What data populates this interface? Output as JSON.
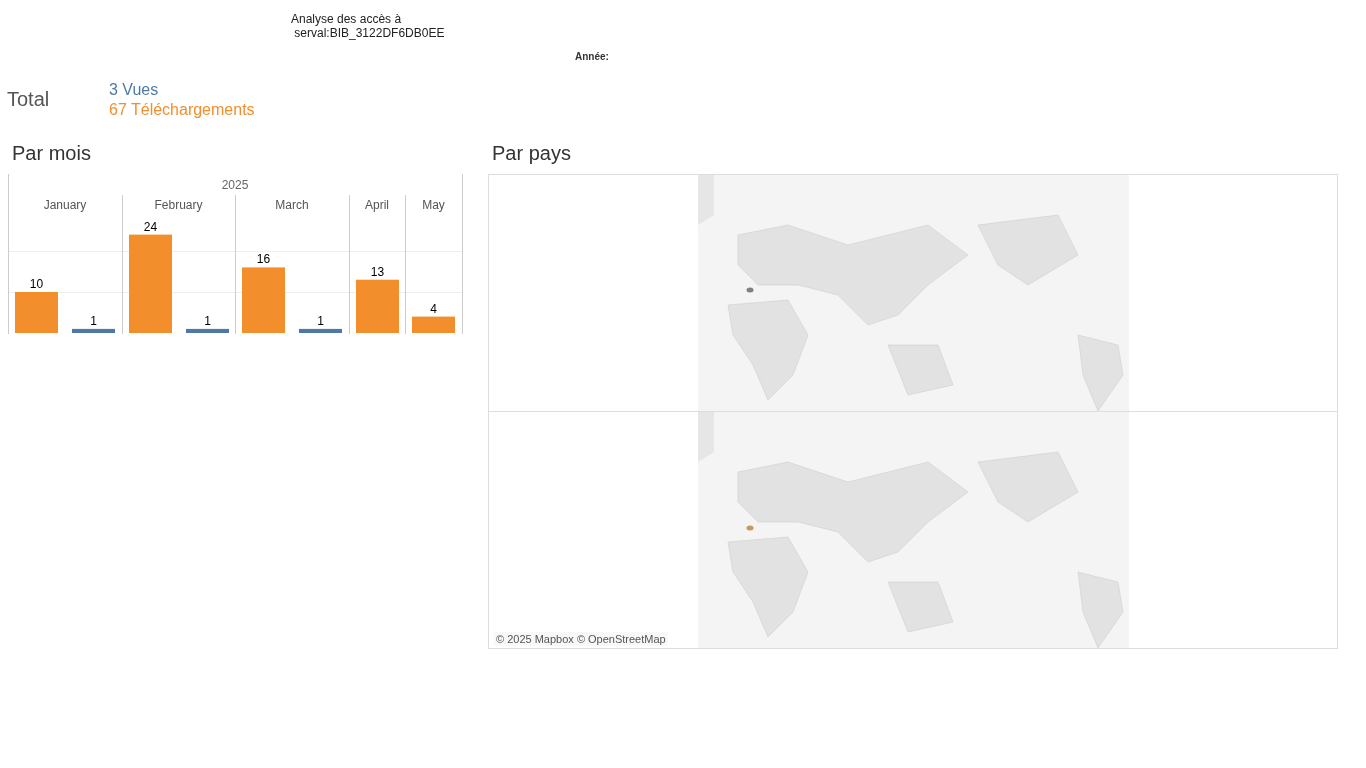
{
  "header": {
    "title": "Analyse des accès à\n serval:BIB_3122DF6DB0EE",
    "year_filter_label": "Année:"
  },
  "totals": {
    "label": "Total",
    "lines": [
      {
        "text": "3 Vues",
        "color": "#4e79a7"
      },
      {
        "text": "67 Téléchargements",
        "color": "#f28e2b"
      }
    ]
  },
  "monthly": {
    "title": "Par mois",
    "chart_data": {
      "type": "bar",
      "title": "2025",
      "categories": [
        "January",
        "February",
        "March",
        "April",
        "May"
      ],
      "series": [
        {
          "color": "#f28e2b",
          "values": [
            10,
            24,
            16,
            13,
            4
          ]
        },
        {
          "color": "#4e79a7",
          "values": [
            1,
            1,
            1,
            null,
            null
          ]
        }
      ],
      "data_labels": true
    }
  },
  "countries": {
    "title": "Par pays",
    "maps": [
      {
        "color": "#7f7f7f"
      },
      {
        "color": "#c9955a"
      }
    ],
    "attribution": "© 2025 Mapbox © OpenStreetMap"
  }
}
